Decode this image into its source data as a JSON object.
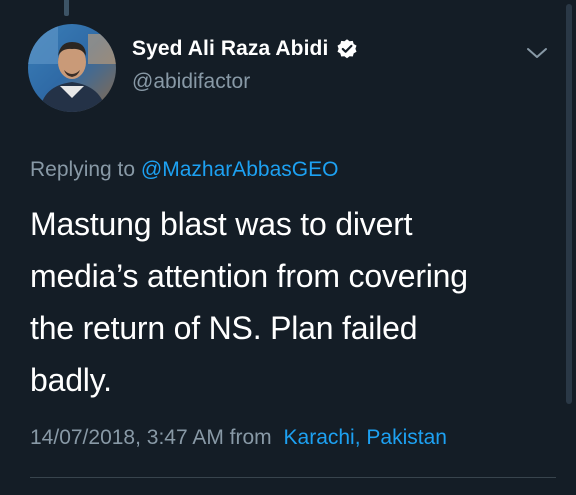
{
  "tweet": {
    "author_name": "Syed Ali Raza Abidi",
    "author_handle": "@abidifactor",
    "replying_prefix": "Replying to",
    "replying_to": "@MazharAbbasGEO",
    "lines": [
      "Mastung blast was to divert",
      "media’s attention from covering",
      "the return of NS. Plan failed",
      "badly."
    ],
    "timestamp": "14/07/2018, 3:47 AM",
    "from_label": "from",
    "location": "Karachi, Pakistan"
  },
  "colors": {
    "background": "#141d26",
    "accent": "#1da1f2",
    "muted_text": "#8899a6",
    "primary_text": "#ffffff"
  },
  "icons": {
    "verified": "verified-badge-icon",
    "menu": "chevron-down-icon"
  }
}
